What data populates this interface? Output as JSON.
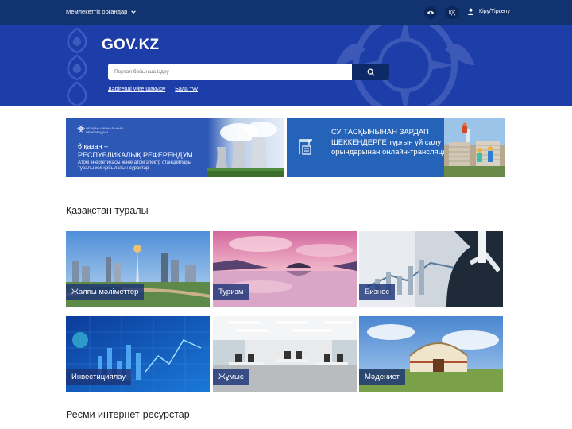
{
  "topbar": {
    "org_select": "Мемлекеттік органдар",
    "lang": "ҚҚ",
    "login": "Кіру",
    "separator": "/",
    "register": "Тіркелу"
  },
  "hero": {
    "logo": "GOV.KZ",
    "search_placeholder": "Портал бойынша іздеу",
    "links": [
      "Дәрігерді үйге шақыру",
      "Бала туу"
    ]
  },
  "banners": {
    "left": {
      "logo_text": "ОБЩЕНАЦИОНАЛЬНЫЙ РЕФЕРЕНДУМ",
      "title_line1": "6 қазан –",
      "title_line2": "РЕСПУБЛИКАЛЫҚ РЕФЕРЕНДУМ",
      "subtitle": "Атом энергетикасы және атом электр станциялары туралы жиі қойылатын сұрақтар"
    },
    "right": {
      "title": "СУ ТАСҚЫНЫНАН ЗАРДАП ШЕККЕНДЕРГЕ тұрғын үй салу орындарынан онлайн-трансляция"
    }
  },
  "sections": {
    "about": "Қазақстан туралы",
    "resources": "Ресми интернет-ресурстар"
  },
  "tiles": [
    {
      "label": "Жалпы мәліметтер"
    },
    {
      "label": "Туризм"
    },
    {
      "label": "Бизнес"
    },
    {
      "label": "Инвестициялау"
    },
    {
      "label": "Жұмыс"
    },
    {
      "label": "Мәдениет"
    }
  ],
  "colors": {
    "topbar": "#113470",
    "hero": "#1d3ea8",
    "search_button": "#0c2a66",
    "tile_label": "#1c3478"
  }
}
